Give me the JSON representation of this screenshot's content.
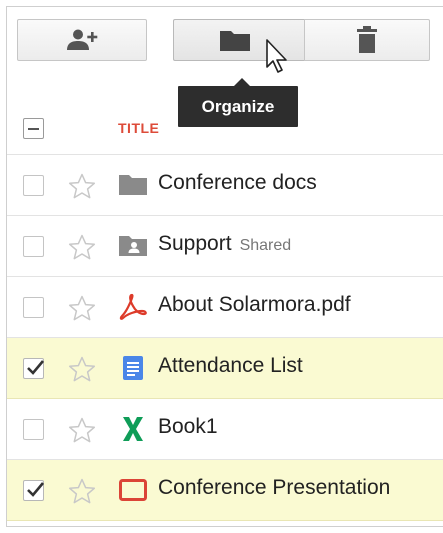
{
  "toolbar": {
    "add_people_icon": "person-add-icon",
    "organize_icon": "folder-icon",
    "delete_icon": "trash-icon",
    "tooltip": "Organize"
  },
  "list": {
    "title_header": "TITLE",
    "rows": [
      {
        "name": "Conference docs",
        "badge": "",
        "type": "folder-icon",
        "checked": false,
        "starred": false
      },
      {
        "name": "Support",
        "badge": "Shared",
        "type": "shared-folder-icon",
        "checked": false,
        "starred": false
      },
      {
        "name": "About Solarmora.pdf",
        "badge": "",
        "type": "pdf-icon",
        "checked": false,
        "starred": false
      },
      {
        "name": "Attendance List",
        "badge": "",
        "type": "document-icon",
        "checked": true,
        "starred": false
      },
      {
        "name": "Book1",
        "badge": "",
        "type": "spreadsheet-icon",
        "checked": false,
        "starred": false
      },
      {
        "name": "Conference Presentation",
        "badge": "",
        "type": "presentation-icon",
        "checked": true,
        "starred": false
      }
    ]
  },
  "colors": {
    "title_header": "#dd4b39",
    "selected_row": "#fafad2",
    "document": "#4a86e8",
    "spreadsheet": "#0f9d58",
    "presentation": "#db4437",
    "pdf": "#dd3b2a"
  }
}
